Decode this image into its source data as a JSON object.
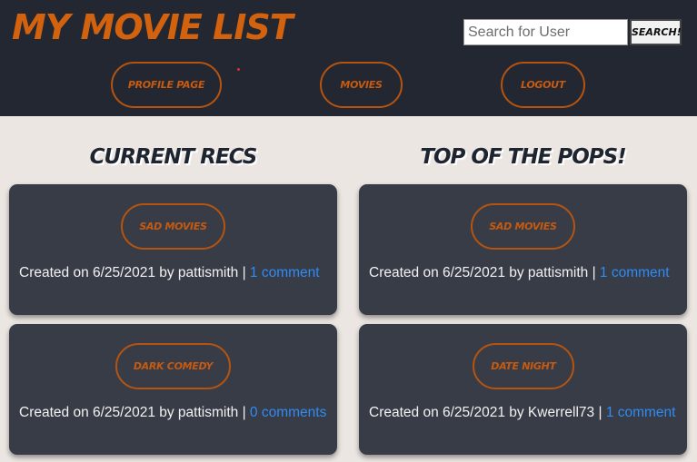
{
  "header": {
    "brand": "MY MOVIE LIST",
    "search_placeholder": "Search for User",
    "search_button": "SEARCH!",
    "nav": {
      "profile": "PROFILE PAGE",
      "movies": "MOVIES",
      "logout": "LOGOUT"
    }
  },
  "columns": {
    "left_title": "CURRENT RECS",
    "right_title": "TOP OF THE POPS!"
  },
  "cards": [
    {
      "list": "SAD MOVIES",
      "prefix": "Created on 6/25/2021 by pattismith | ",
      "comments": "1 comment"
    },
    {
      "list": "DARK COMEDY",
      "prefix": "Created on 6/25/2021 by pattismith | ",
      "comments": "0 comments"
    },
    {
      "list": "SAD MOVIES",
      "prefix": "Created on 6/25/2021 by pattismith | ",
      "comments": "1 comment"
    },
    {
      "list": "DATE NIGHT",
      "prefix": "Created on 6/25/2021 by Kwerrell73 | ",
      "comments": "1 comment"
    }
  ],
  "colors": {
    "header_bg": "#222731",
    "accent": "#c75a0f",
    "page_bg": "#ebe6e2",
    "card_bg": "#383c47",
    "link": "#2f8bf5"
  }
}
